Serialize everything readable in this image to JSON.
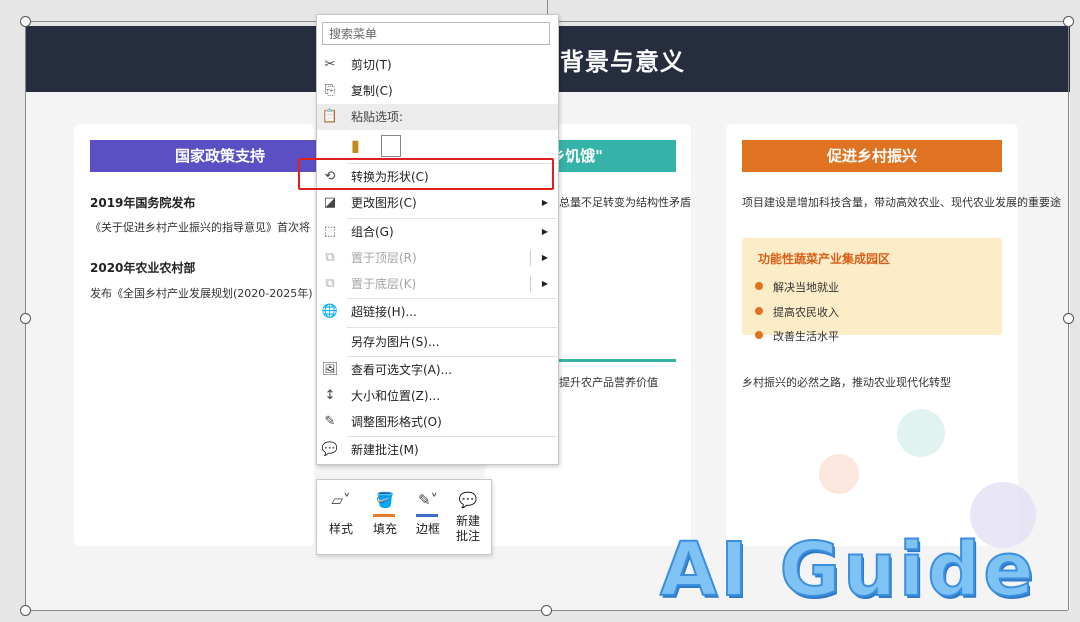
{
  "slide": {
    "title": "背景与意义",
    "card1": {
      "pill": "国家政策支持",
      "pill_color": "#5b4fc4",
      "item1_title": "2019年国务院发布",
      "item1_text": "《关于促进乡村产业振兴的指导意见》首次将",
      "item2_title": "2020年农业农村部",
      "item2_text": "发布《全国乡村产业发展规划(2020-2025年)"
    },
    "card2": {
      "pill": "乡饥饿\"",
      "pill_color": "#36b3a8",
      "text1": "总量不足转变为结构性矛盾",
      "text2": "提升农产品营养价值"
    },
    "card3": {
      "pill": "促进乡村振兴",
      "pill_color": "#e07322",
      "text1": "项目建设是增加科技含量，带动高效农业、现代农业发展的重要途",
      "box_title": "功能性蔬菜产业集成园区",
      "bullets": [
        "解决当地就业",
        "提高农民收入",
        "改善生活水平"
      ],
      "footer": "乡村振兴的必然之路，推动农业现代化转型"
    }
  },
  "menu": {
    "search_placeholder": "搜索菜单",
    "cut": "剪切(T)",
    "copy": "复制(C)",
    "paste_options": "粘贴选项:",
    "convert_to_shape": "转换为形状(C)",
    "change_shape": "更改图形(C)",
    "group": "组合(G)",
    "bring_to_front": "置于顶层(R)",
    "send_to_back": "置于底层(K)",
    "hyperlink": "超链接(H)...",
    "save_as_picture": "另存为图片(S)...",
    "view_alt_text": "查看可选文字(A)...",
    "size_position": "大小和位置(Z)...",
    "format_shape": "调整图形格式(O)",
    "new_comment": "新建批注(M)"
  },
  "mini_toolbar": {
    "style": "样式",
    "fill": "填充",
    "border": "边框",
    "new_comment": "新建\n批注",
    "fill_color": "#e8772e",
    "border_color": "#3b6fc6"
  },
  "watermark": "AI Guide",
  "colors": {
    "header": "#252d3f",
    "highlight": "#e02020"
  }
}
